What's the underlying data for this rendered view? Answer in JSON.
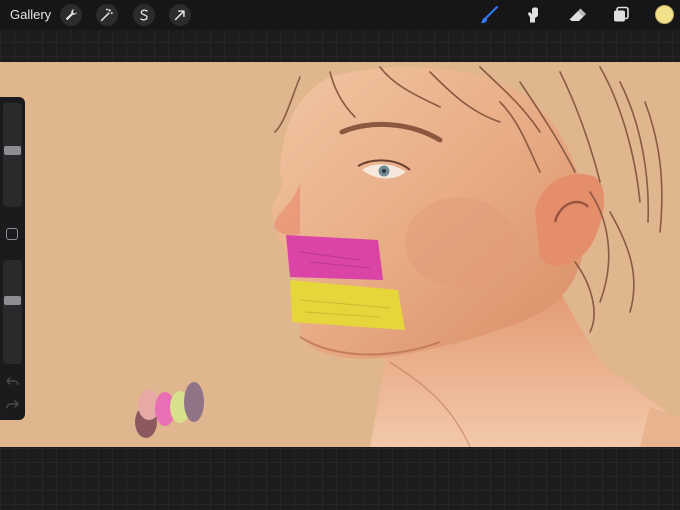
{
  "topbar": {
    "gallery_label": "Gallery",
    "left_tools": [
      {
        "name": "actions",
        "icon": "wrench-icon"
      },
      {
        "name": "adjustments",
        "icon": "magic-wand-icon"
      },
      {
        "name": "selection",
        "icon": "selection-s-icon"
      },
      {
        "name": "transform",
        "icon": "arrow-cursor-icon"
      }
    ],
    "right_tools": [
      {
        "name": "brush",
        "icon": "brush-icon",
        "active": true
      },
      {
        "name": "smudge",
        "icon": "smudge-finger-icon"
      },
      {
        "name": "eraser",
        "icon": "eraser-icon"
      },
      {
        "name": "layers",
        "icon": "layers-icon"
      }
    ],
    "current_color": "#f2e08a",
    "accent_color": "#2f7bff"
  },
  "sidebar": {
    "brush_size_level": 0.55,
    "opacity_level": 0.62,
    "buttons": [
      "modify-button",
      "undo-button",
      "redo-button"
    ]
  },
  "canvas": {
    "background_color": "#e0b68e",
    "tape_colors": [
      "#d944a6",
      "#e6d63b"
    ],
    "palette_colors": [
      "#8c5a5e",
      "#e6a9a6",
      "#e86fb4",
      "#d9e08c",
      "#8f7387"
    ]
  }
}
